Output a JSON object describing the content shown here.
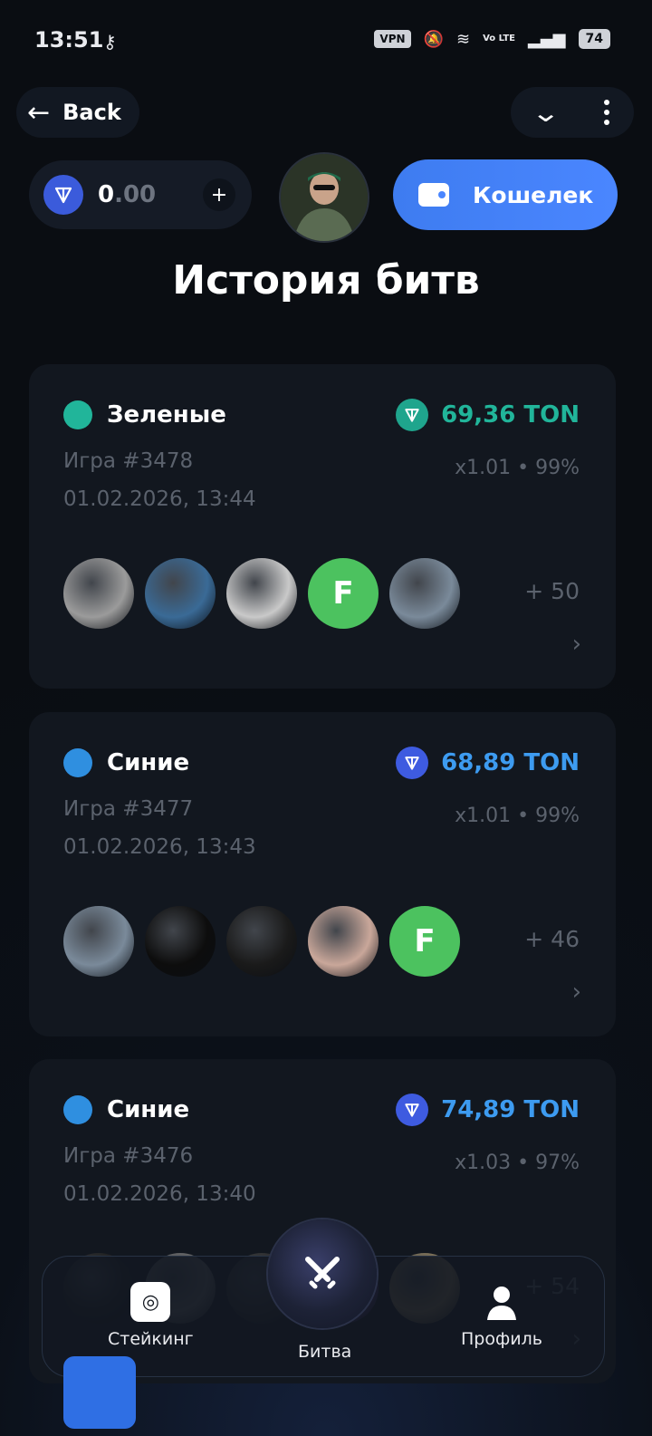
{
  "status": {
    "time": "13:51",
    "vpn": "VPN",
    "volte": "Vo LTE",
    "battery": "74"
  },
  "header": {
    "back_label": "Back"
  },
  "balance": {
    "integer": "0",
    "decimal": ".00",
    "plus": "+"
  },
  "wallet": {
    "label": "Кошелек"
  },
  "title": "История битв",
  "battles": [
    {
      "team": "Зеленые",
      "team_color": "#21b59a",
      "amount": "69,36 TON",
      "amount_color": "#21b59a",
      "coin_color": "#1fa58d",
      "game": "Игра #3478",
      "multiplier": "x1.01 • 99%",
      "date": "01.02.2026, 13:44",
      "more": "+ 50",
      "players": [
        {
          "type": "img",
          "bg": "#9b9b9b"
        },
        {
          "type": "img",
          "bg": "#3a6a96"
        },
        {
          "type": "img",
          "bg": "#c9c9c9"
        },
        {
          "type": "letter",
          "letter": "F"
        },
        {
          "type": "img",
          "bg": "#7a8a9a"
        }
      ]
    },
    {
      "team": "Синие",
      "team_color": "#2f8fe0",
      "amount": "68,89 TON",
      "amount_color": "#3d9bf0",
      "coin_color": "#3e5be0",
      "game": "Игра #3477",
      "multiplier": "x1.01 • 99%",
      "date": "01.02.2026, 13:43",
      "more": "+ 46",
      "players": [
        {
          "type": "img",
          "bg": "#7a8a9a"
        },
        {
          "type": "img",
          "bg": "#0d0d0d"
        },
        {
          "type": "img",
          "bg": "#1a1a1a"
        },
        {
          "type": "img",
          "bg": "#c9a79a"
        },
        {
          "type": "letter",
          "letter": "F"
        }
      ]
    },
    {
      "team": "Синие",
      "team_color": "#2f8fe0",
      "amount": "74,89 TON",
      "amount_color": "#3d9bf0",
      "coin_color": "#3e5be0",
      "game": "Игра #3476",
      "multiplier": "x1.03 • 97%",
      "date": "01.02.2026, 13:40",
      "more": "+ 54",
      "players": [
        {
          "type": "img",
          "bg": "#1a1a1a"
        },
        {
          "type": "img",
          "bg": "#6a6a6a"
        },
        {
          "type": "img",
          "bg": "#2a2a2a"
        },
        {
          "type": "img",
          "bg": "#5a3b8a"
        },
        {
          "type": "img",
          "bg": "#8a7a5a"
        }
      ]
    }
  ],
  "nav": {
    "staking": "Стейкинг",
    "battle": "Битва",
    "profile": "Профиль"
  }
}
